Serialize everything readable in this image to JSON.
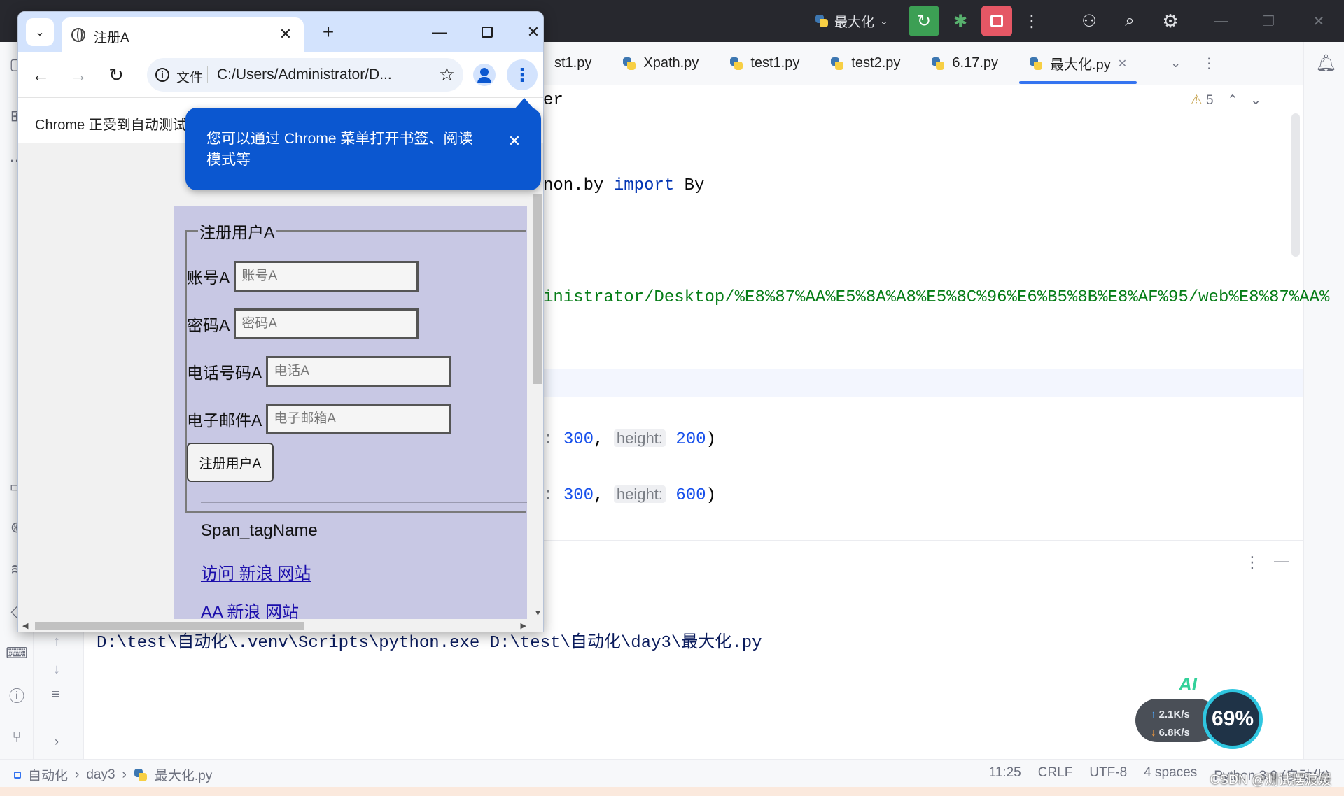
{
  "ide": {
    "run_config": "最大化",
    "tabs": [
      {
        "label": "st1.py",
        "active": false
      },
      {
        "label": "Xpath.py",
        "active": false
      },
      {
        "label": "test1.py",
        "active": false
      },
      {
        "label": "test2.py",
        "active": false
      },
      {
        "label": "6.17.py",
        "active": false
      },
      {
        "label": "最大化.py",
        "active": true
      }
    ],
    "warnings_count": "5",
    "code": {
      "l1_text": "er",
      "l2_text": "non.by ",
      "l2_kw": "import",
      "l2_tail": " By",
      "l3_str": "inistrator/Desktop/%E8%87%AA%E5%8A%A8%E5%8C%96%E6%B5%8B%E8%AF%95/web%E8%87%AA%",
      "l4_colon": ": ",
      "l4_w": "300",
      "l4_comma": ", ",
      "l4_hint": "height:",
      "l4_h": "200",
      "l4_close": ")",
      "l5_colon": ": ",
      "l5_w": "300",
      "l5_comma": ", ",
      "l5_hint": "height:",
      "l5_h": "600",
      "l5_close": ")"
    },
    "run_command": "D:\\test\\自动化\\.venv\\Scripts\\python.exe D:\\test\\自动化\\day3\\最大化.py",
    "breadcrumb": [
      "自动化",
      "day3",
      "最大化.py"
    ],
    "status": {
      "position": "11:25",
      "line_sep": "CRLF",
      "encoding": "UTF-8",
      "indent": "4 spaces",
      "interpreter": "Python 3.9 (自动化)"
    },
    "watermark": "CSDN @测试摆渡媛",
    "net": {
      "up": "2.1K/s",
      "down": "6.8K/s",
      "percent": "69%",
      "ai_label": "AI"
    }
  },
  "chrome": {
    "tab_title": "注册A",
    "omnibox_chip": "文件",
    "url": "C:/Users/Administrator/D...",
    "infobar": "Chrome 正受到自动测试",
    "bubble_text": "您可以通过 Chrome 菜单打开书签、阅读模式等",
    "page": {
      "legend": "注册用户A",
      "fields": [
        {
          "label": "账号A",
          "placeholder": "账号A"
        },
        {
          "label": "密码A",
          "placeholder": "密码A"
        },
        {
          "label": "电话号码A",
          "placeholder": "电话A"
        },
        {
          "label": "电子邮件A",
          "placeholder": "电子邮箱A"
        }
      ],
      "submit": "注册用户A",
      "span_tag": "Span_tagName",
      "links": [
        "访问 新浪 网站",
        "AA 新浪 网站"
      ]
    }
  },
  "colors": {
    "ide_titlebar": "#27282e",
    "accent_blue": "#3574f0",
    "chrome_tabstrip": "#d3e3fd",
    "bubble": "#0b57d0",
    "page_box": "#c8c8e4",
    "link": "#1a0dab"
  }
}
